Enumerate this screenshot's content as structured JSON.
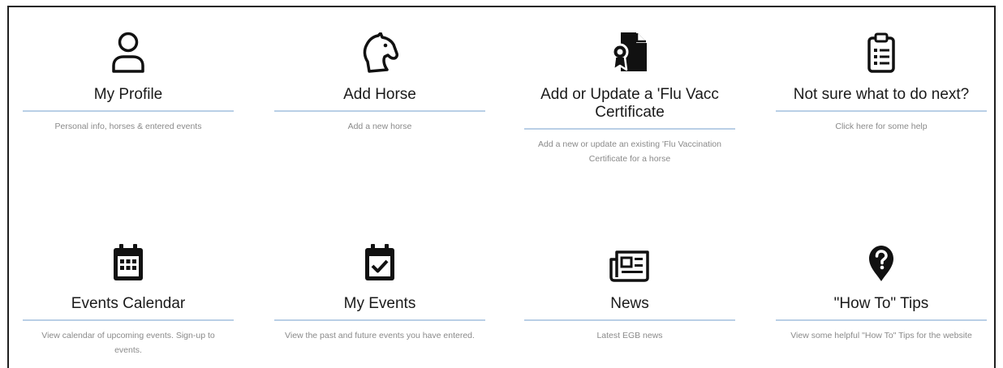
{
  "tiles": [
    {
      "icon": "user-icon",
      "title": "My Profile",
      "desc": "Personal info, horses & entered events"
    },
    {
      "icon": "horse-head-icon",
      "title": "Add Horse",
      "desc": "Add a new horse"
    },
    {
      "icon": "certificate-icon",
      "title": "Add or Update a 'Flu Vacc Certificate",
      "desc": "Add a new or update an existing 'Flu Vaccination Certificate for a horse"
    },
    {
      "icon": "clipboard-list-icon",
      "title": "Not sure what to do next?",
      "desc": "Click here for some help"
    },
    {
      "icon": "calendar-icon",
      "title": "Events Calendar",
      "desc": "View calendar of upcoming events. Sign-up to events."
    },
    {
      "icon": "calendar-check-icon",
      "title": "My Events",
      "desc": "View the past and future events you have entered."
    },
    {
      "icon": "newspaper-icon",
      "title": "News",
      "desc": "Latest EGB news"
    },
    {
      "icon": "question-marker-icon",
      "title": "\"How To\" Tips",
      "desc": "View some helpful \"How To\" Tips for the website"
    }
  ],
  "colors": {
    "icon": "#111111",
    "title": "#1a1a1a",
    "desc": "#8a8a8a",
    "underline": "#b9cfe6"
  }
}
